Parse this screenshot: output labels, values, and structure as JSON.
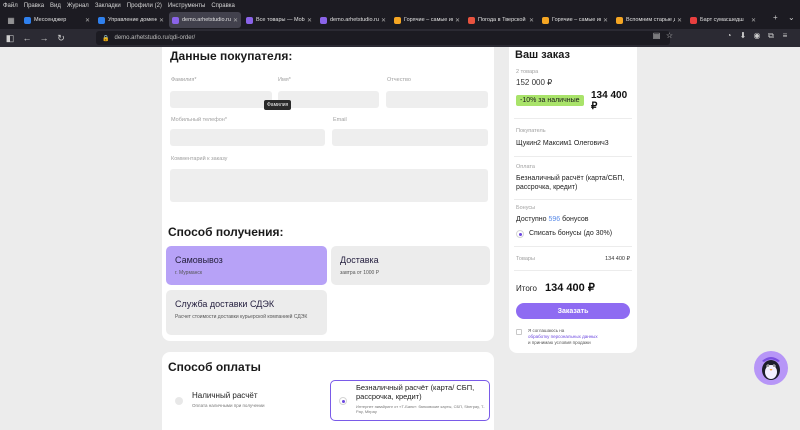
{
  "menu": [
    "Файл",
    "Правка",
    "Вид",
    "Журнал",
    "Закладки",
    "Профили (2)",
    "Инструменты",
    "Справка"
  ],
  "tabs": [
    {
      "title": "Мессенджер",
      "color": "#2f80ed",
      "active": false
    },
    {
      "title": "Управление доменом",
      "color": "#2f80ed",
      "active": false
    },
    {
      "title": "demo.arhetstudio.ru/q",
      "color": "#8a63e8",
      "active": true
    },
    {
      "title": "Все товары — Mobile",
      "color": "#8a63e8",
      "active": false
    },
    {
      "title": "demo.arhetstudio.ru/q",
      "color": "#8a63e8",
      "active": false
    },
    {
      "title": "Горячие – самые инте",
      "color": "#f5a623",
      "active": false
    },
    {
      "title": "Погода в Тверской ре",
      "color": "#e8533f",
      "active": false
    },
    {
      "title": "Горячие – самые инте",
      "color": "#f5a623",
      "active": false
    },
    {
      "title": "Вспомним старые дос",
      "color": "#f5a623",
      "active": false
    },
    {
      "title": "Барт сумасшедш",
      "color": "#e83f3f",
      "active": false
    }
  ],
  "url": "demo.arhetstudio.ru/qdi-order/",
  "buyer": {
    "title": "Данные покупателя:",
    "surname": "Фамилия*",
    "name": "Имя*",
    "patronymic": "Отчество",
    "tooltip": "Фамилия",
    "phone": "Мобильный телефон*",
    "email": "Email",
    "comment": "Комментарий к заказу"
  },
  "delivery": {
    "title": "Способ получения:",
    "options": [
      {
        "title": "Самовывоз",
        "sub": "г. Мурманск"
      },
      {
        "title": "Доставка",
        "sub": "завтра от 1000 Р"
      },
      {
        "title": "Служба доставки СДЭК",
        "sub": "Расчет стоимости доставки курьерской компанией СДЭК"
      }
    ]
  },
  "payment": {
    "title": "Способ оплаты",
    "options": [
      {
        "title": "Наличный расчёт",
        "sub": "Оплата наличными при получении"
      },
      {
        "title": "Безналичный расчёт (карта/ СБП, рассрочка, кредит)",
        "sub": "Интернет эквайринг от «Т-Банк»: банковские карты, СБП, Sberpay, T-Pay, Mirpay"
      }
    ]
  },
  "summary": {
    "title": "Ваш заказ",
    "count": "2 товара",
    "old_price": "152 000 ₽",
    "discount": "-10% за наличные",
    "price": "134 400 ₽",
    "buyer_label": "Покупатель",
    "buyer_name": "Щукин2 Максим1 Олегович3",
    "payment_label": "Оплата",
    "payment_value": "Безналичный расчёт (карта/СБП, рассрочка, кредит)",
    "bonus_label": "Бонусы",
    "bonus_available_prefix": "Доступно",
    "bonus_amount": "596",
    "bonus_unit": "бонусов",
    "bonus_writeoff": "Списать бонусы (до 30%)",
    "goods_label": "Товары",
    "goods_value": "134 400 ₽",
    "total_label": "Итого",
    "total_value": "134 400 ₽",
    "button": "Заказать",
    "consent_1": "Я соглашаюсь на",
    "consent_2": "обработку персональных данных",
    "consent_3": "и принимаю условия продажи"
  },
  "colors": {
    "accent": "#8e6bf2",
    "selected_option": "#b7a2f7",
    "discount_badge": "#a9e36a"
  }
}
